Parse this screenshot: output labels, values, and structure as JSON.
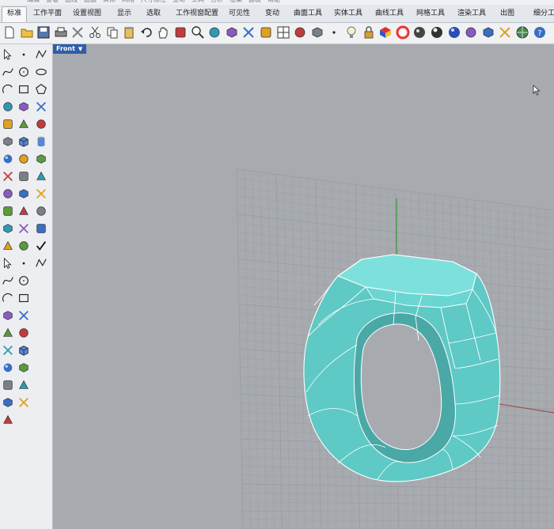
{
  "menu": {
    "items": [
      "编辑",
      "查看",
      "曲线",
      "曲面",
      "实体",
      "网格",
      "尺寸标注",
      "变动",
      "工具",
      "分析",
      "渲染",
      "面板",
      "帮助"
    ]
  },
  "tabs": [
    {
      "label": "标准",
      "active": true
    },
    {
      "label": "工作平面",
      "active": false
    },
    {
      "label": "设置视图",
      "active": false
    },
    {
      "label": "显示",
      "active": false
    },
    {
      "label": "选取",
      "active": false
    },
    {
      "label": "工作视窗配置",
      "active": false
    },
    {
      "label": "可见性",
      "active": false
    },
    {
      "label": "变动",
      "active": false
    },
    {
      "label": "曲面工具",
      "active": false
    },
    {
      "label": "实体工具",
      "active": false
    },
    {
      "label": "曲线工具",
      "active": false
    },
    {
      "label": "网格工具",
      "active": false
    },
    {
      "label": "渲染工具",
      "active": false
    },
    {
      "label": "出图",
      "active": false
    },
    {
      "label": "细分工",
      "active": false
    }
  ],
  "toolbar": {
    "icons": [
      "new-file-icon",
      "open-folder-icon",
      "save-icon",
      "print-icon",
      "import-icon",
      "cut-icon",
      "copy-icon",
      "paste-icon",
      "undo-icon",
      "pan-hand-icon",
      "move-view-icon",
      "zoom-icon",
      "zoom-window-icon",
      "zoom-extents-icon",
      "zoom-selected-icon",
      "rotate-view-icon",
      "four-viewports-icon",
      "car-display-icon",
      "grid-snap-icon",
      "point-icon",
      "light-bulb-icon",
      "lock-icon",
      "material-icon",
      "color-wheel-icon",
      "shaded-sphere-icon",
      "render-sphere-icon",
      "blue-sphere-icon",
      "highlight-icon",
      "gear-settings-icon",
      "points-on-icon",
      "globe-icon",
      "help-icon"
    ]
  },
  "sidebar": {
    "icons": [
      "select-arrow-icon",
      "point-icon",
      "polyline-icon",
      "curve-icon",
      "circle-icon",
      "ellipse-icon",
      "arc-icon",
      "rectangle-icon",
      "polygon-icon",
      "fillet-curve-icon",
      "offset-icon",
      "trim-icon",
      "surface-icon",
      "extrude-icon",
      "sweep-icon",
      "loft-icon",
      "box-icon",
      "cylinder-icon",
      "sphere-icon",
      "boolean-icon",
      "mesh-icon",
      "transform-icon",
      "move-icon",
      "rotate-icon",
      "scale-icon",
      "mirror-icon",
      "array-icon",
      "join-icon",
      "explode-icon",
      "group-icon",
      "text-icon",
      "dimension-icon",
      "hatch-icon",
      "layer-icon",
      "properties-icon",
      "check-icon"
    ]
  },
  "viewport": {
    "label": "Front",
    "dropdown_arrow": "▼",
    "background": "#a7abaf",
    "grid_color": "#9a9ea3",
    "x_axis_color": "#a05050",
    "y_axis_color": "#3a9a3a",
    "object_color": "#6ed6d2",
    "object_edge_color": "#ffffff",
    "object": "ring-mesh"
  }
}
